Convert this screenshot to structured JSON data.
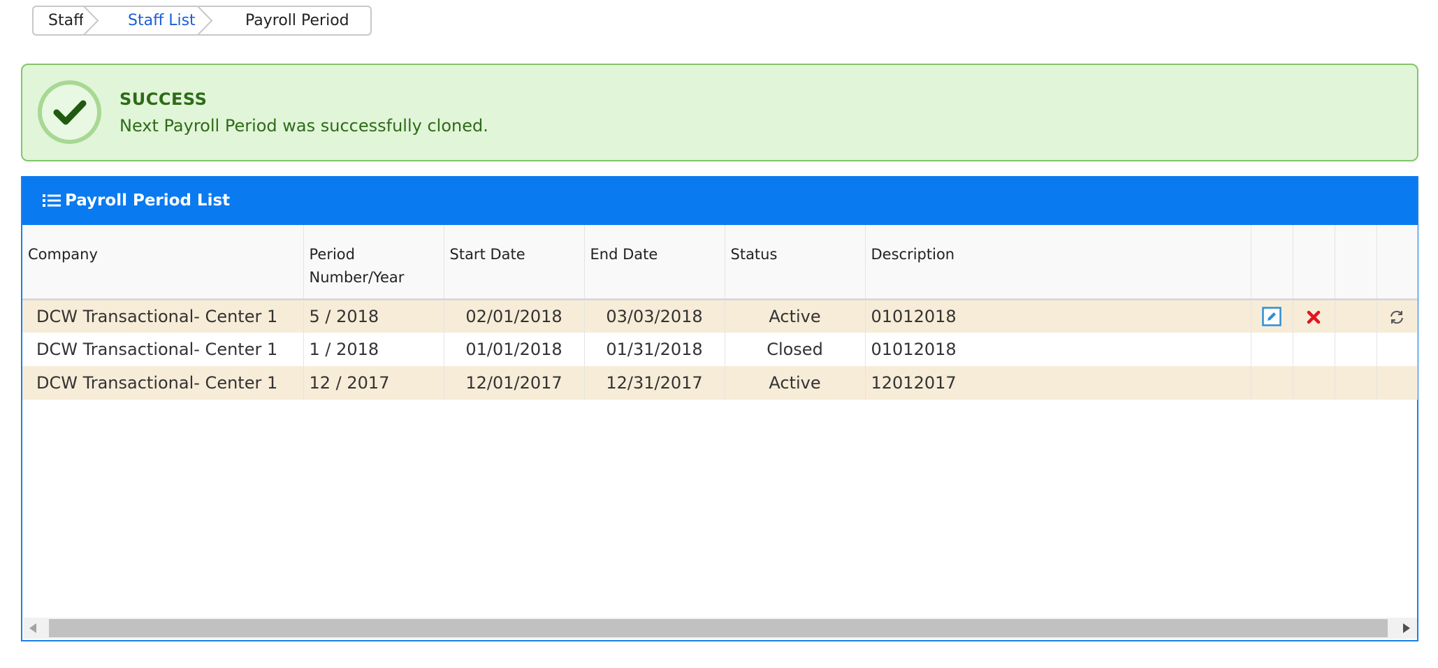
{
  "breadcrumb": {
    "items": [
      {
        "label": "Staff"
      },
      {
        "label": "Staff List"
      },
      {
        "label": "Payroll Period"
      }
    ]
  },
  "alert": {
    "icon": "check-circle-icon",
    "title": "SUCCESS",
    "message": "Next Payroll Period was successfully cloned.",
    "color": "#2e6b19",
    "background": "#e1f5d8"
  },
  "panel": {
    "icon": "list-icon",
    "title": "Payroll Period List",
    "header_color": "#0a7af0"
  },
  "table": {
    "columns": {
      "company": "Company",
      "period_line1": "Period",
      "period_line2": "Number/Year",
      "start": "Start Date",
      "end": "End Date",
      "status": "Status",
      "description": "Description"
    },
    "rows": [
      {
        "company": "DCW Transactional- Center 1",
        "period": "5 / 2018",
        "start": "02/01/2018",
        "end": "03/03/2018",
        "status": "Active",
        "description": "01012018"
      },
      {
        "company": "DCW Transactional- Center 1",
        "period": "1 / 2018",
        "start": "01/01/2018",
        "end": "01/31/2018",
        "status": "Closed",
        "description": "01012018"
      },
      {
        "company": "DCW Transactional- Center 1",
        "period": "12 / 2017",
        "start": "12/01/2017",
        "end": "12/31/2017",
        "status": "Active",
        "description": "12012017"
      }
    ],
    "row_actions": [
      "edit-icon",
      "delete-icon",
      "refresh-icon"
    ]
  }
}
